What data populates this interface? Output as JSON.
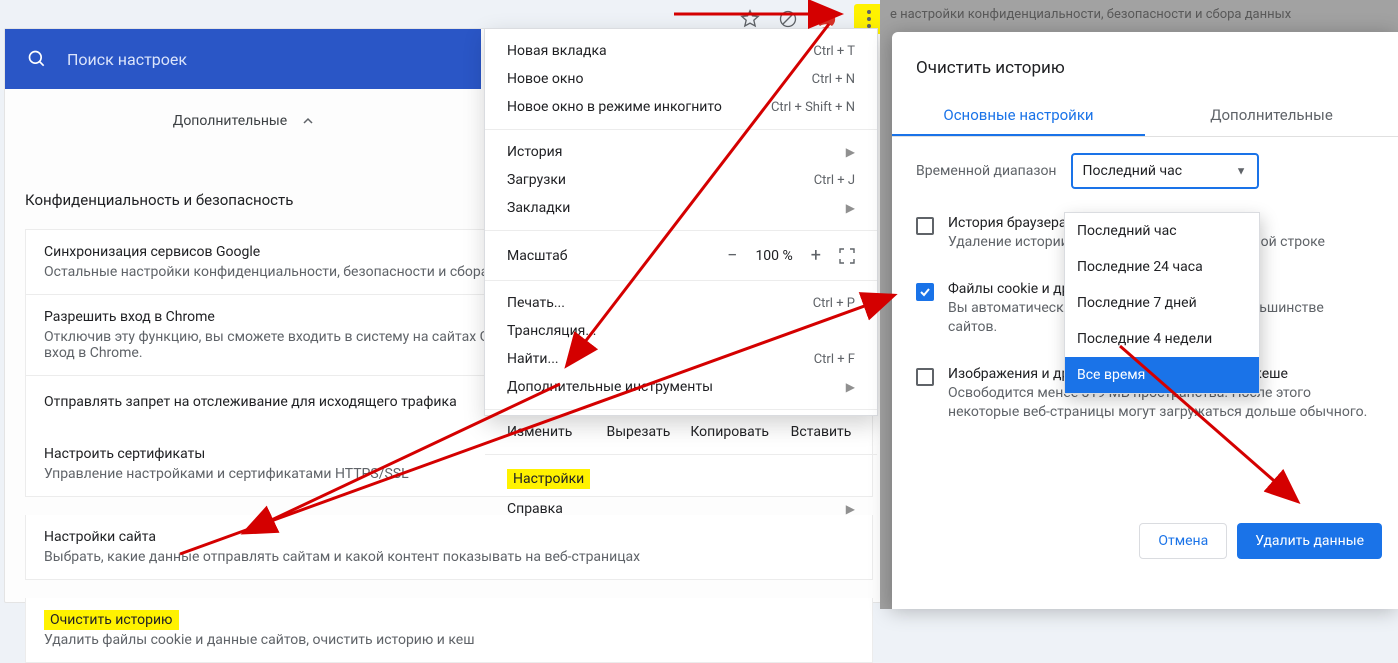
{
  "search": {
    "placeholder": "Поиск настроек"
  },
  "additional_label": "Дополнительные",
  "section_title": "Конфиденциальность и безопасность",
  "bg_text": "е настройки конфиденциальности, безопасности и сбора данных",
  "cards": [
    {
      "title": "Синхронизация сервисов Google",
      "sub": "Остальные настройки конфиденциальности, безопасности и сбора данных"
    },
    {
      "title": "Разрешить вход в Chrome",
      "sub": "Отключив эту функцию, вы сможете входить в систему на сайтах Google (например, Gmail) без необходимости выполнять вход в Chrome."
    },
    {
      "title": "Отправлять запрет на отслеживание для исходящего трафика",
      "sub": ""
    },
    {
      "title": "Настроить сертификаты",
      "sub": "Управление настройками и сертификатами HTTPS/SSL"
    },
    {
      "title": "Настройки сайта",
      "sub": "Выбрать, какие данные отправлять сайтам и какой контент показывать на веб-страницах"
    },
    {
      "title": "Очистить историю",
      "sub": "Удалить файлы cookie и данные сайтов, очистить историю и кеш"
    }
  ],
  "menu": {
    "new_tab": "Новая вкладка",
    "new_tab_sc": "Ctrl + T",
    "new_win": "Новое окно",
    "new_win_sc": "Ctrl + N",
    "incog": "Новое окно в режиме инкогнито",
    "incog_sc": "Ctrl + Shift + N",
    "history": "История",
    "downloads": "Загрузки",
    "downloads_sc": "Ctrl + J",
    "bookmarks": "Закладки",
    "zoom_lbl": "Масштаб",
    "zoom_pct": "100 %",
    "print": "Печать...",
    "print_sc": "Ctrl + P",
    "cast": "Трансляция...",
    "find": "Найти...",
    "find_sc": "Ctrl + F",
    "more_tools": "Дополнительные инструменты",
    "edit": "Изменить",
    "cut": "Вырезать",
    "copy": "Копировать",
    "paste": "Вставить",
    "settings": "Настройки",
    "help": "Справка"
  },
  "dialog": {
    "title": "Очистить историю",
    "tab_basic": "Основные настройки",
    "tab_advanced": "Дополнительные",
    "range_label": "Временной диапазон",
    "range_value": "Последний час",
    "options": [
      "Последний час",
      "Последние 24 часа",
      "Последние 7 дней",
      "Последние 4 недели",
      "Все время"
    ],
    "items": [
      {
        "checked": false,
        "title": "История браузера",
        "sub": "Удаление истории и автоподстановок в адресной строке"
      },
      {
        "checked": true,
        "title": "Файлы cookie и другие данные сайтов",
        "sub": "Вы автоматически выйдете из аккаунта на большинстве сайтов."
      },
      {
        "checked": false,
        "title": "Изображения и другие файлы, сохраненные в кеше",
        "sub": "Освободится менее 319 МБ пространства. После этого некоторые веб-страницы могут загружаться дольше обычного."
      }
    ],
    "cancel": "Отмена",
    "confirm": "Удалить данные"
  }
}
